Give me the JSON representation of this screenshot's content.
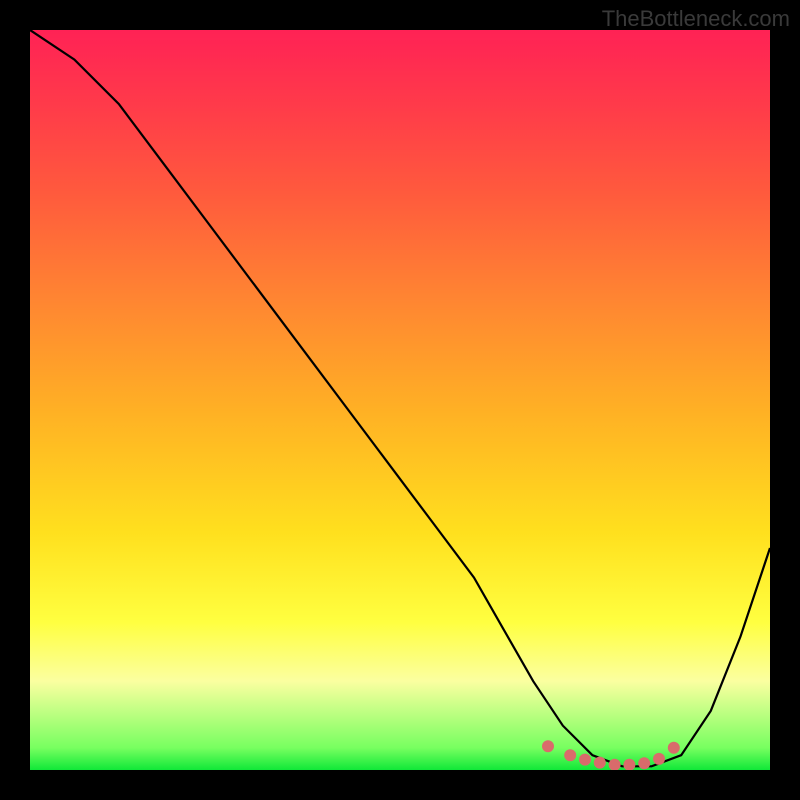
{
  "watermark_text": "TheBottleneck.com",
  "chart_data": {
    "type": "line",
    "title": "",
    "xlabel": "",
    "ylabel": "",
    "xlim": [
      0,
      100
    ],
    "ylim": [
      0,
      100
    ],
    "series": [
      {
        "name": "bottleneck-curve",
        "x": [
          0,
          6,
          12,
          18,
          24,
          30,
          36,
          42,
          48,
          54,
          60,
          64,
          68,
          72,
          76,
          80,
          84,
          88,
          92,
          96,
          100
        ],
        "y": [
          100,
          96,
          90,
          82,
          74,
          66,
          58,
          50,
          42,
          34,
          26,
          19,
          12,
          6,
          2,
          0.5,
          0.5,
          2,
          8,
          18,
          30
        ]
      }
    ],
    "highlight_points": {
      "name": "optimal-range-dots",
      "x": [
        70,
        73,
        75,
        77,
        79,
        81,
        83,
        85,
        87
      ],
      "y": [
        3.2,
        2.0,
        1.4,
        1.0,
        0.7,
        0.7,
        0.9,
        1.5,
        3.0
      ]
    },
    "background_gradient": {
      "top": "#ff2255",
      "mid": "#ffe01e",
      "bottom": "#10e838"
    }
  }
}
